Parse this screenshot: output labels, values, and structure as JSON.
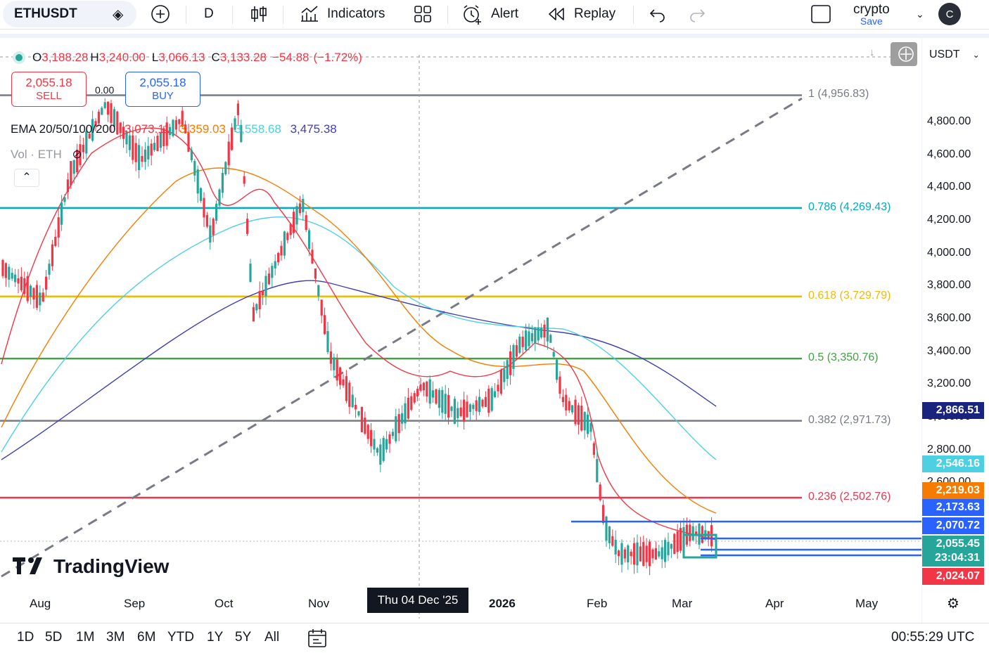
{
  "toolbar": {
    "symbol": "ETHUSDT",
    "interval": "D",
    "indicators_label": "Indicators",
    "alert_label": "Alert",
    "replay_label": "Replay",
    "layout_name": "crypto",
    "save_label": "Save",
    "avatar": "C"
  },
  "legend": {
    "open_label": "O",
    "open": "3,188.28",
    "high_label": "H",
    "high": "3,240.00",
    "low_label": "L",
    "low": "3,066.13",
    "close_label": "C",
    "close": "3,133.28",
    "change": "−54.88",
    "change_pct": "(−1.72%)",
    "sell_price": "2,055.18",
    "sell_label": "SELL",
    "spread": "0.00",
    "buy_price": "2,055.18",
    "buy_label": "BUY",
    "ema_label": "EMA 20/50/100/200",
    "ema20": "3,073.11",
    "ema50": "3,359.03",
    "ema100": "3,558.68",
    "ema200": "3,475.38",
    "vol_label": "Vol · ETH"
  },
  "fib_levels": [
    {
      "ratio": "1",
      "label": "1 (4,956.83)",
      "price": 4956.83,
      "color": "#787b86"
    },
    {
      "ratio": "0.786",
      "label": "0.786 (4,269.43)",
      "price": 4269.43,
      "color": "#00acc1"
    },
    {
      "ratio": "0.618",
      "label": "0.618 (3,729.79)",
      "price": 3729.79,
      "color": "#f0b90b"
    },
    {
      "ratio": "0.5",
      "label": "0.5 (3,350.76)",
      "price": 3350.76,
      "color": "#43a047"
    },
    {
      "ratio": "0.382",
      "label": "0.382 (2,971.73)",
      "price": 2971.73,
      "color": "#787b86"
    },
    {
      "ratio": "0.236",
      "label": "0.236 (2,502.76)",
      "price": 2502.76,
      "color": "#e53950"
    }
  ],
  "price_axis": {
    "currency": "USDT",
    "ticks": [
      "4,800.00",
      "4,600.00",
      "4,400.00",
      "4,200.00",
      "4,000.00",
      "3,800.00",
      "3,600.00",
      "3,400.00",
      "3,200.00",
      "3,000.00",
      "2,800.00",
      "2,600.00"
    ]
  },
  "price_tags": [
    {
      "value": "2,866.51",
      "color": "#1a237e"
    },
    {
      "value": "2,546.16",
      "color": "#4dd0e1"
    },
    {
      "value": "2,219.03",
      "color": "#f57c00"
    },
    {
      "value": "2,173.63",
      "color": "#2962ff"
    },
    {
      "value": "2,070.72",
      "color": "#2962ff"
    },
    {
      "value": "2,055.45",
      "color": "#26a69a"
    },
    {
      "value": "23:04:31",
      "color": "#26a69a"
    },
    {
      "value": "2,024.07",
      "color": "#f23645"
    }
  ],
  "time_axis": {
    "labels": [
      "Aug",
      "Sep",
      "Oct",
      "Nov",
      "2026",
      "Feb",
      "Mar",
      "Apr",
      "May"
    ],
    "crosshair_date": "Thu 04 Dec '25"
  },
  "ranges": [
    "1D",
    "5D",
    "1M",
    "3M",
    "6M",
    "YTD",
    "1Y",
    "5Y",
    "All"
  ],
  "clock": "00:55:29 UTC",
  "watermark": "TradingView",
  "colors": {
    "up": "#26a69a",
    "down": "#f23645",
    "ema20": "#f23645",
    "ema50": "#f57c00",
    "ema100": "#4dd0e1",
    "ema200": "#3f3fb5"
  }
}
